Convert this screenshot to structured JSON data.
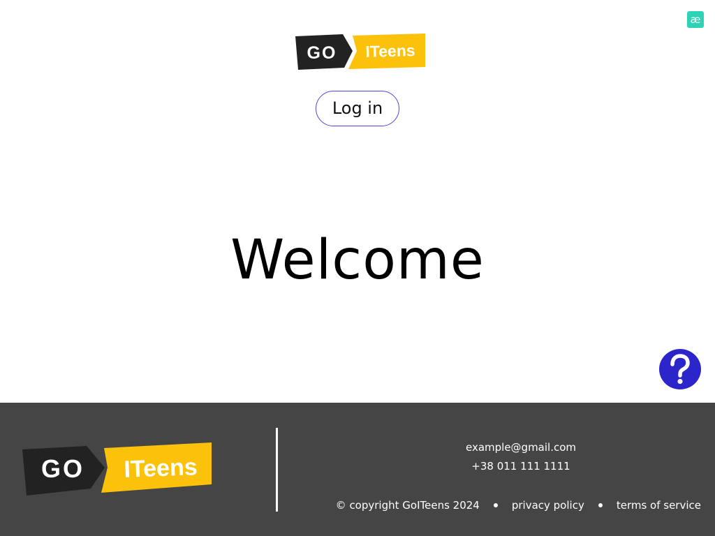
{
  "extension_badge": {
    "glyph": "æ",
    "icon": "ae-extension-icon",
    "color": "#2ed3b5"
  },
  "header": {
    "logo": {
      "part1": "GO",
      "part2": "ITeens",
      "dark_color": "#222222",
      "accent_color": "#fcc10a"
    },
    "login_label": "Log in",
    "login_border_color": "#4b47d6"
  },
  "main": {
    "welcome_title": "Welcome"
  },
  "help_button": {
    "icon": "question-mark-icon",
    "color": "#2c25c9"
  },
  "footer": {
    "background": "#454545",
    "logo": {
      "part1": "GO",
      "part2": "ITeens"
    },
    "email": "example@gmail.com",
    "phone": "+38 011 111 1111",
    "copyright": "© copyright GoITeens 2024",
    "privacy_label": "privacy policy",
    "terms_label": "terms of service"
  }
}
